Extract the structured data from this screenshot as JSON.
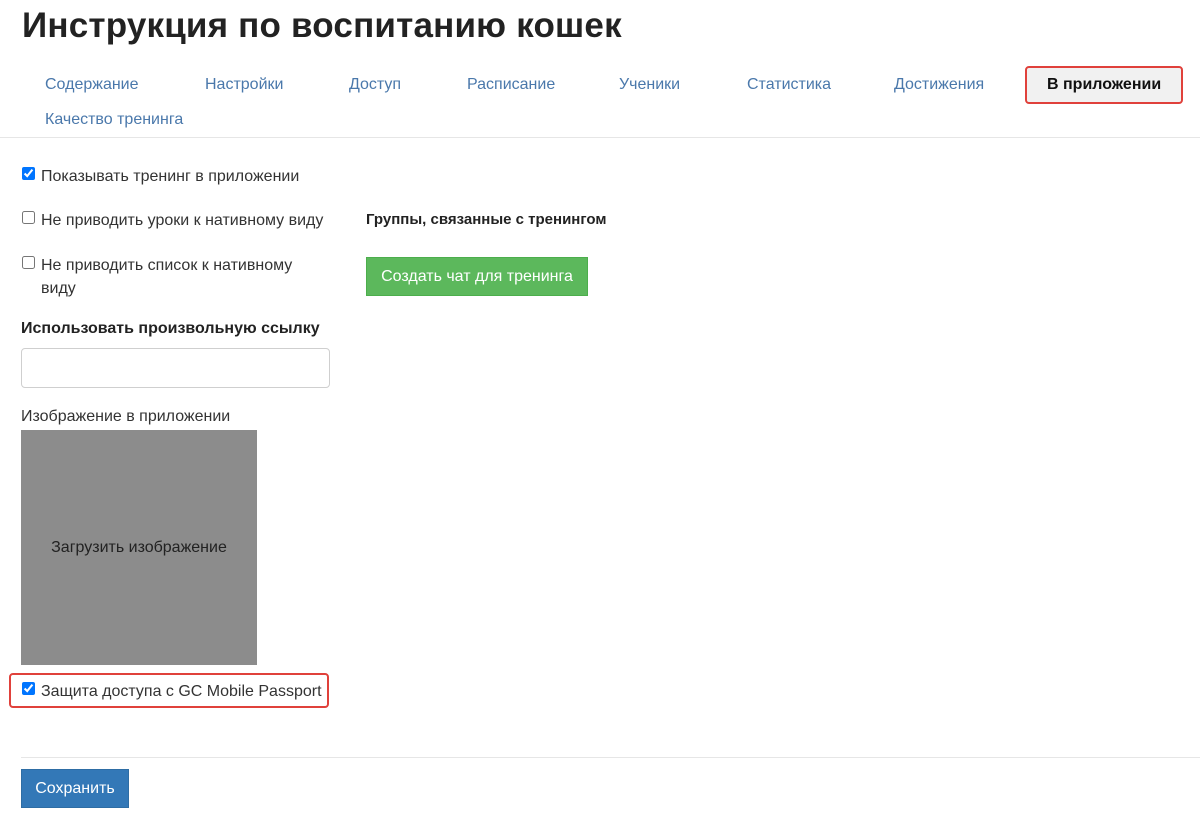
{
  "page": {
    "title": "Инструкция по воспитанию кошек"
  },
  "tabs": [
    {
      "label": "Содержание"
    },
    {
      "label": "Настройки"
    },
    {
      "label": "Доступ"
    },
    {
      "label": "Расписание"
    },
    {
      "label": "Ученики"
    },
    {
      "label": "Статистика"
    },
    {
      "label": "Достижения"
    },
    {
      "label": "В приложении",
      "active": true
    },
    {
      "label": "Качество тренинга"
    }
  ],
  "options": {
    "show_in_app": {
      "label": "Показывать тренинг в приложении",
      "checked": true
    },
    "no_native_lessons": {
      "label": "Не приводить уроки к нативному виду",
      "checked": false
    },
    "no_native_list": {
      "label": "Не приводить список к нативному виду",
      "checked": false
    }
  },
  "custom_link": {
    "label": "Использовать произвольную ссылку",
    "value": ""
  },
  "image": {
    "caption": "Изображение в приложении",
    "upload_label": "Загрузить изображение"
  },
  "passport": {
    "label": "Защита доступа с GC Mobile Passport",
    "checked": true
  },
  "groups": {
    "heading": "Группы, связанные с тренингом",
    "create_chat_label": "Создать чат для тренинга"
  },
  "footer": {
    "save_label": "Сохранить"
  },
  "colors": {
    "link": "#4a78ab",
    "highlight": "#e0413b",
    "success": "#5cb85c",
    "primary": "#3378b7"
  }
}
